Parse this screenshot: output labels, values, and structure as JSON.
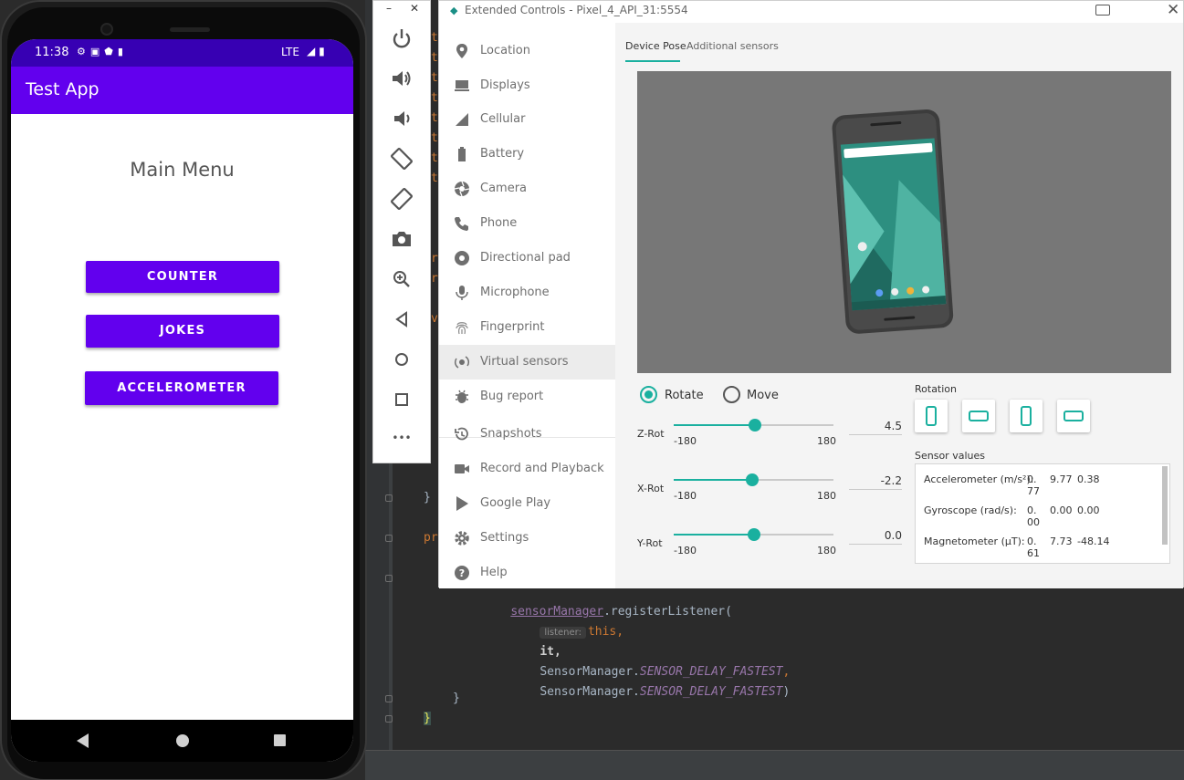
{
  "emulator_phone": {
    "status_time": "11:38",
    "status_network": "LTE",
    "app_title": "Test App",
    "main_heading": "Main Menu",
    "buttons": {
      "counter": "COUNTER",
      "jokes": "JOKES",
      "accelerometer": "ACCELEROMETER"
    },
    "colors": {
      "status_bar": "#3700b3",
      "app_bar": "#6200ee",
      "button": "#6200ee"
    }
  },
  "emulator_toolbar": {
    "minimize": "–",
    "close": "✕",
    "buttons": [
      "power-icon",
      "volume-up-icon",
      "volume-down-icon",
      "rotate-left-icon",
      "rotate-right-icon",
      "camera-icon",
      "zoom-icon",
      "back-icon",
      "home-icon",
      "overview-icon",
      "more-icon"
    ],
    "more_label": "•••"
  },
  "extended_controls": {
    "title": "Extended Controls - Pixel_4_API_31:5554",
    "sidebar": [
      {
        "label": "Location",
        "icon": "location-pin-icon"
      },
      {
        "label": "Displays",
        "icon": "display-icon"
      },
      {
        "label": "Cellular",
        "icon": "cellular-signal-icon"
      },
      {
        "label": "Battery",
        "icon": "battery-icon"
      },
      {
        "label": "Camera",
        "icon": "camera-aperture-icon"
      },
      {
        "label": "Phone",
        "icon": "phone-handset-icon"
      },
      {
        "label": "Directional pad",
        "icon": "dpad-icon"
      },
      {
        "label": "Microphone",
        "icon": "microphone-icon"
      },
      {
        "label": "Fingerprint",
        "icon": "fingerprint-icon"
      },
      {
        "label": "Virtual sensors",
        "icon": "virtual-sensors-icon",
        "active": true
      },
      {
        "label": "Bug report",
        "icon": "bug-icon"
      },
      {
        "label": "Snapshots",
        "icon": "history-icon"
      },
      {
        "label": "Record and Playback",
        "icon": "video-camera-icon"
      },
      {
        "label": "Google Play",
        "icon": "play-store-icon"
      },
      {
        "label": "Settings",
        "icon": "gear-icon"
      },
      {
        "label": "Help",
        "icon": "help-icon"
      }
    ],
    "tabs": {
      "device_pose": "Device Pose",
      "additional_sensors": "Additional sensors"
    },
    "mode": {
      "rotate": "Rotate",
      "move": "Move",
      "selected": "rotate"
    },
    "sliders": [
      {
        "label": "Z-Rot",
        "min": "-180",
        "max": "180",
        "value": "4.5",
        "level": 0.51
      },
      {
        "label": "X-Rot",
        "min": "-180",
        "max": "180",
        "value": "-2.2",
        "level": 0.49
      },
      {
        "label": "Y-Rot",
        "min": "-180",
        "max": "180",
        "value": "0.0",
        "level": 0.5
      }
    ],
    "rotation_label": "Rotation",
    "rotation_buttons": [
      "portrait-icon",
      "landscape-icon",
      "reverse-portrait-icon",
      "reverse-landscape-icon"
    ],
    "sensor_values_label": "Sensor values",
    "sensor_values": [
      {
        "name": "Accelerometer (m/s²):",
        "v1a": "0.",
        "v1b": "77",
        "v2": "9.77",
        "v3": "0.38"
      },
      {
        "name": "Gyroscope (rad/s):",
        "v1a": "0.",
        "v1b": "00",
        "v2": "0.00",
        "v3": "0.00"
      },
      {
        "name": "Magnetometer (μT):",
        "v1a": "0.",
        "v1b": "61",
        "v2": "7.73",
        "v3": "-48.14"
      }
    ],
    "accent_color": "#1ab09f"
  },
  "code_editor": {
    "left_chars": [
      "t",
      "t",
      "t",
      "t",
      "t",
      "t",
      "t",
      "t",
      "r",
      "r",
      "v"
    ],
    "line_brace1": "}",
    "line_pr": "pr",
    "register_field": "sensorManager",
    "register_call": ".registerListener(",
    "hint_listener": "listener:",
    "arg_this": "this,",
    "arg_it": "it,",
    "sensor_class": "SensorManager.",
    "sensor_const": "SENSOR_DELAY_FASTEST",
    "comma": ",",
    "close_paren": ")",
    "brace_inner": "}",
    "brace_outer": "}"
  }
}
